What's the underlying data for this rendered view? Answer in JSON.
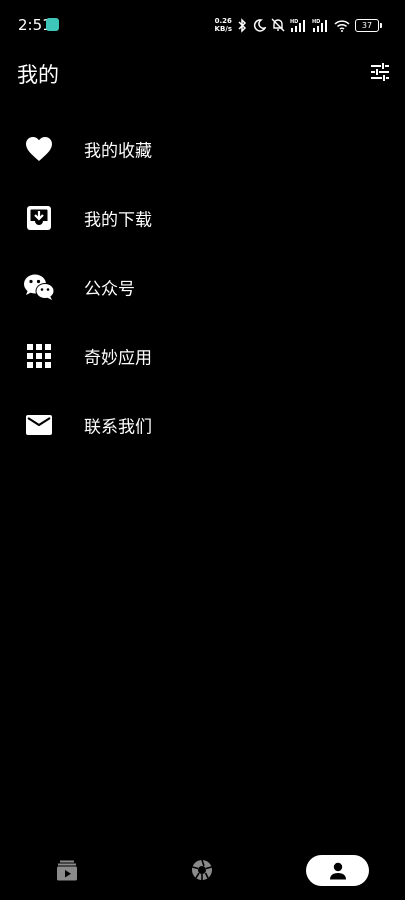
{
  "status_bar": {
    "time": "2:51",
    "net_speed_value": "0.26",
    "net_speed_unit": "KB/s",
    "battery": "37",
    "icons": [
      "bluetooth-icon",
      "moon-icon",
      "bell-off-icon",
      "hd-signal-icon",
      "hd-signal-icon",
      "wifi-icon",
      "battery-icon"
    ]
  },
  "header": {
    "title": "我的",
    "settings_icon": "sliders-icon"
  },
  "menu": {
    "items": [
      {
        "label": "我的收藏",
        "icon": "heart-icon"
      },
      {
        "label": "我的下载",
        "icon": "download-box-icon"
      },
      {
        "label": "公众号",
        "icon": "wechat-icon"
      },
      {
        "label": "奇妙应用",
        "icon": "apps-grid-icon"
      },
      {
        "label": "联系我们",
        "icon": "mail-icon"
      }
    ]
  },
  "bottom_nav": {
    "tabs": [
      {
        "icon": "video-library-icon",
        "active": false
      },
      {
        "icon": "aperture-icon",
        "active": false
      },
      {
        "icon": "person-icon",
        "active": true
      }
    ],
    "colors": {
      "active_bg": "#ffffff",
      "inactive_icon": "#8a8a8a"
    }
  }
}
